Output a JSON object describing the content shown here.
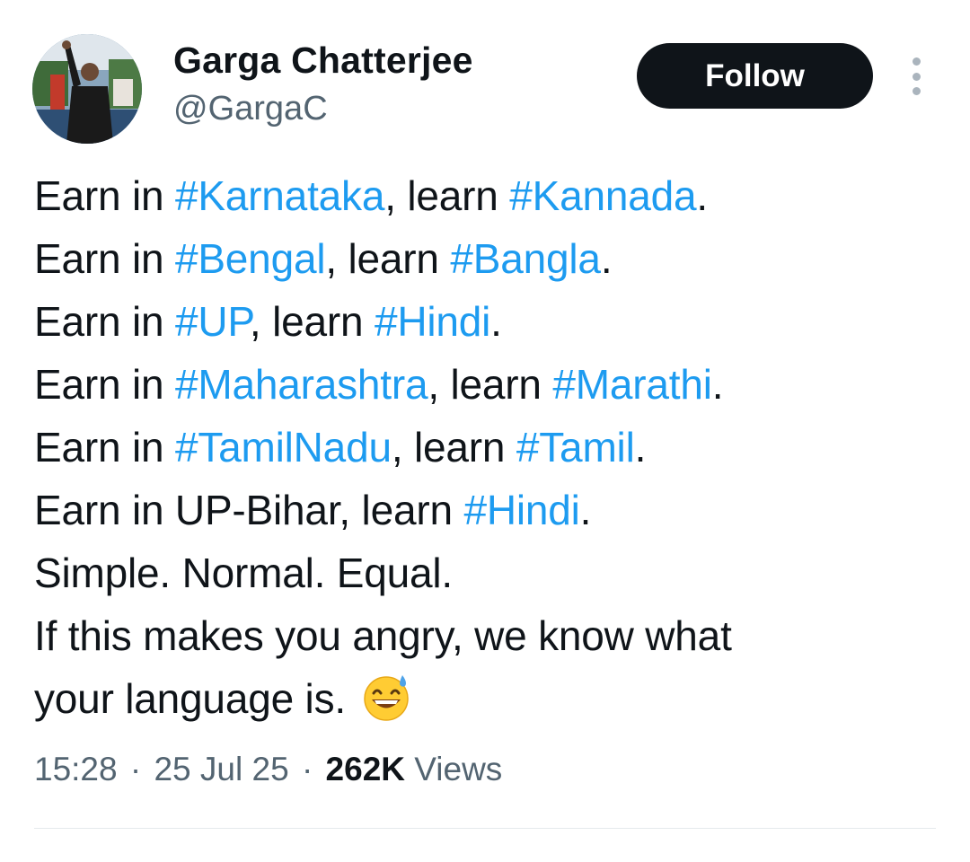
{
  "author": {
    "name": "Garga Chatterjee",
    "handle": "@GargaC"
  },
  "actions": {
    "follow_label": "Follow",
    "more_icon": "more-vertical-icon"
  },
  "tweet": {
    "lines": [
      {
        "segments": [
          {
            "text": "Earn in ",
            "hashtag": false
          },
          {
            "text": "#Karnataka",
            "hashtag": true
          },
          {
            "text": ", learn ",
            "hashtag": false
          },
          {
            "text": "#Kannada",
            "hashtag": true
          },
          {
            "text": ".",
            "hashtag": false
          }
        ]
      },
      {
        "segments": [
          {
            "text": "Earn in ",
            "hashtag": false
          },
          {
            "text": "#Bengal",
            "hashtag": true
          },
          {
            "text": ", learn ",
            "hashtag": false
          },
          {
            "text": "#Bangla",
            "hashtag": true
          },
          {
            "text": ".",
            "hashtag": false
          }
        ]
      },
      {
        "segments": [
          {
            "text": "Earn in ",
            "hashtag": false
          },
          {
            "text": "#UP",
            "hashtag": true
          },
          {
            "text": ", learn ",
            "hashtag": false
          },
          {
            "text": "#Hindi",
            "hashtag": true
          },
          {
            "text": ".",
            "hashtag": false
          }
        ]
      },
      {
        "segments": [
          {
            "text": "Earn in ",
            "hashtag": false
          },
          {
            "text": "#Maharashtra",
            "hashtag": true
          },
          {
            "text": ", learn ",
            "hashtag": false
          },
          {
            "text": "#Marathi",
            "hashtag": true
          },
          {
            "text": ".",
            "hashtag": false
          }
        ]
      },
      {
        "segments": [
          {
            "text": "Earn in ",
            "hashtag": false
          },
          {
            "text": "#TamilNadu",
            "hashtag": true
          },
          {
            "text": ", learn ",
            "hashtag": false
          },
          {
            "text": "#Tamil",
            "hashtag": true
          },
          {
            "text": ".",
            "hashtag": false
          }
        ]
      },
      {
        "segments": [
          {
            "text": "Earn in UP-Bihar, learn ",
            "hashtag": false
          },
          {
            "text": "#Hindi",
            "hashtag": true
          },
          {
            "text": ".",
            "hashtag": false
          }
        ]
      },
      {
        "segments": [
          {
            "text": "Simple. Normal. Equal.",
            "hashtag": false
          }
        ]
      },
      {
        "segments": [
          {
            "text": "If this makes you angry, we know what",
            "hashtag": false
          }
        ]
      },
      {
        "segments": [
          {
            "text": "your language is. ",
            "hashtag": false
          }
        ],
        "emoji": "grinning-sweat-emoji"
      }
    ]
  },
  "meta": {
    "time": "15:28",
    "date": "25 Jul 25",
    "views_count": "262K",
    "views_label": "Views",
    "separator": "·"
  },
  "colors": {
    "hashtag": "#1d9bf0",
    "text": "#0f1419",
    "secondary": "#536471",
    "follow_bg": "#0f1419"
  }
}
